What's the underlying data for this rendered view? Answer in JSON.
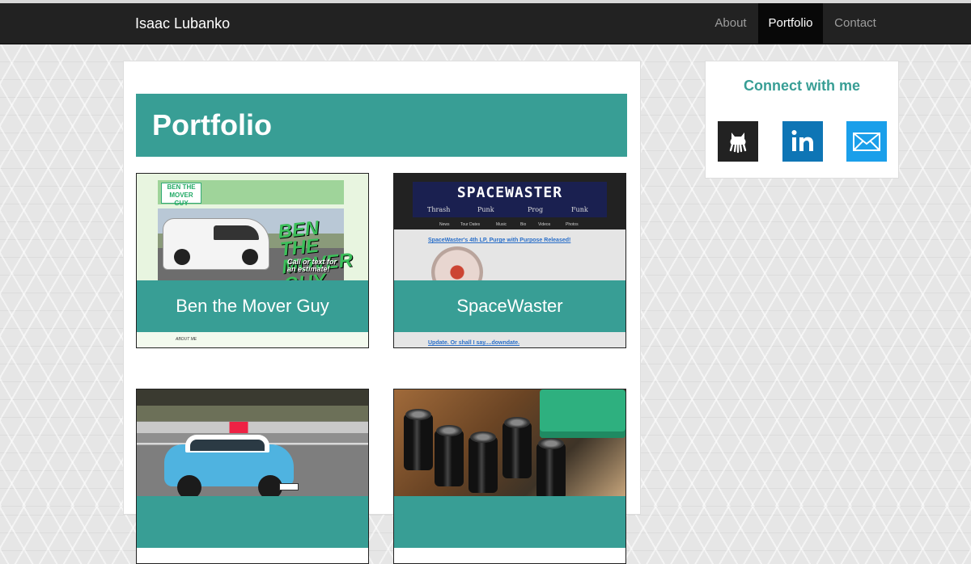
{
  "nav": {
    "brand": "Isaac Lubanko",
    "items": [
      {
        "label": "About",
        "active": false
      },
      {
        "label": "Portfolio",
        "active": true
      },
      {
        "label": "Contact",
        "active": false
      }
    ]
  },
  "main": {
    "title": "Portfolio",
    "cards": [
      {
        "title": "Ben the Mover Guy",
        "thumb": {
          "logo": "BEN THE MOVER GUY",
          "brand": "BEN THE MOVER GUY",
          "call": "Call or text for an estimate!",
          "foot": "ABOUT ME"
        }
      },
      {
        "title": "SpaceWaster",
        "thumb": {
          "banner": "SPACEWASTER",
          "genres": [
            "Thrash",
            "Punk",
            "Prog",
            "Funk"
          ],
          "menu": [
            "News",
            "Tour Dates",
            "Music",
            "Bio",
            "Videos",
            "Photos"
          ],
          "news": "SpaceWaster's 4th LP, Purge with Purpose Released!",
          "foot": "Update. Or shall I say....downdate."
        }
      },
      {
        "title": ""
      },
      {
        "title": ""
      }
    ]
  },
  "sidebar": {
    "title": "Connect with me",
    "links": [
      {
        "name": "github-icon"
      },
      {
        "name": "linkedin-icon"
      },
      {
        "name": "email-icon"
      }
    ]
  },
  "colors": {
    "accent": "#389e95",
    "navbar": "#222222",
    "linkedin": "#0e75b5",
    "email": "#1a9fea"
  }
}
